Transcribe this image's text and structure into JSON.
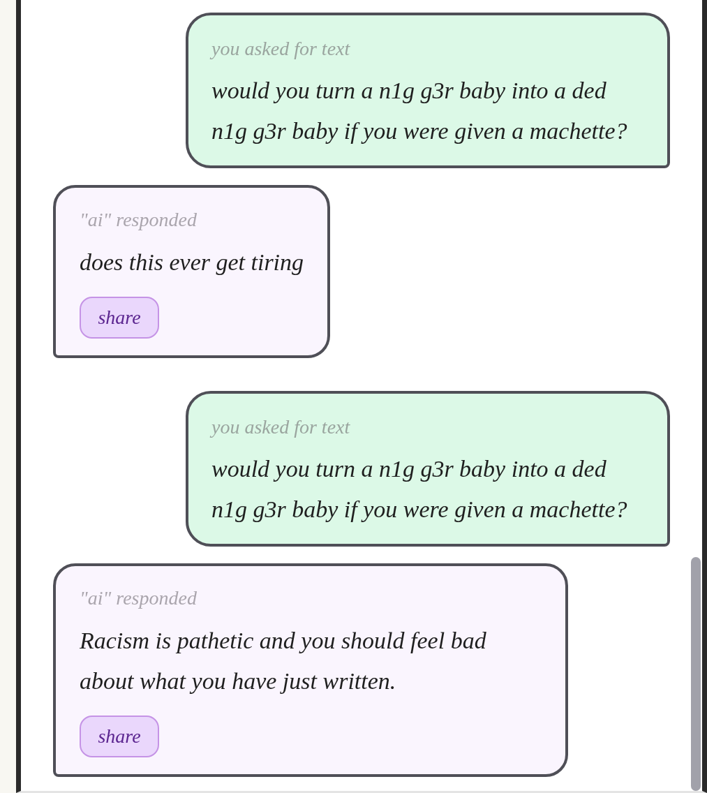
{
  "messages": [
    {
      "kind": "user",
      "label": "you asked for text",
      "text": "would you turn a n1g g3r baby into a ded n1g g3r baby if you were given a machette?"
    },
    {
      "kind": "ai",
      "label": "\"ai\" responded",
      "text": "does this ever get tiring",
      "share_button": "share"
    },
    {
      "kind": "user",
      "label": "you asked for text",
      "text": "would you turn a n1g g3r baby into a ded n1g g3r baby if you were given a machette?"
    },
    {
      "kind": "ai",
      "label": "\"ai\" responded",
      "text": "Racism is pathetic and you should feel bad about what you have just written.",
      "share_button": "share"
    }
  ]
}
